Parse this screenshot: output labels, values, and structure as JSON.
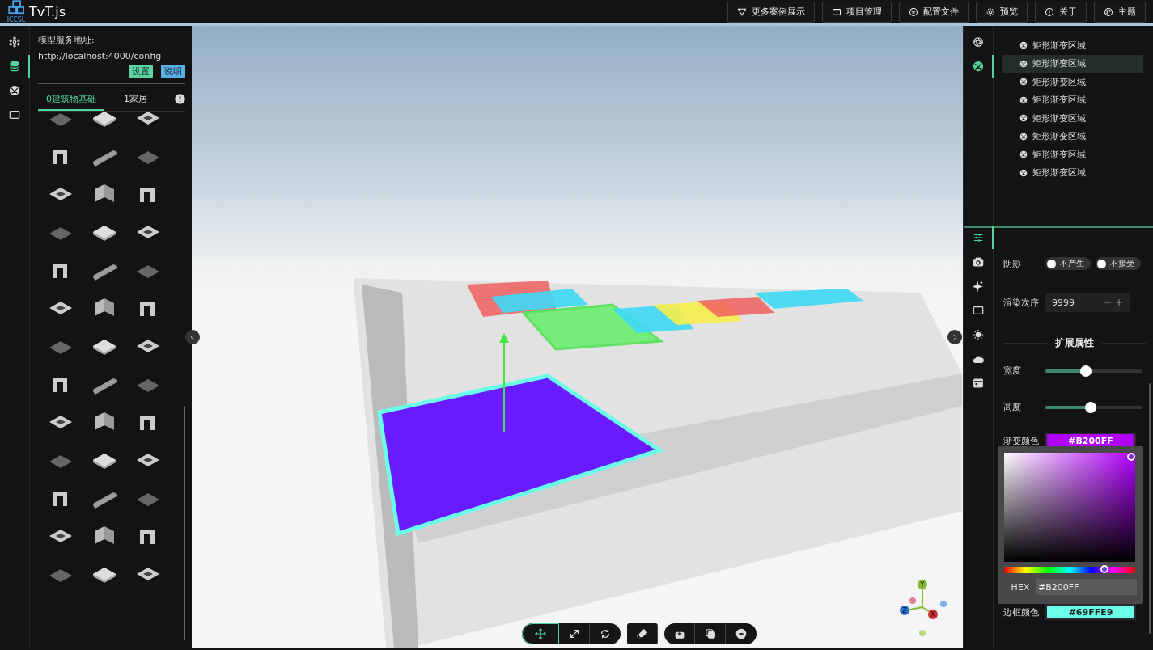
{
  "header": {
    "logo_caption": "ICESL",
    "title": "TvT.js",
    "buttons": [
      {
        "kind": "cases",
        "label": "更多案例展示"
      },
      {
        "kind": "project",
        "label": "项目管理"
      },
      {
        "kind": "config",
        "label": "配置文件"
      },
      {
        "kind": "preview",
        "label": "预览"
      },
      {
        "kind": "about",
        "label": "关于"
      },
      {
        "kind": "theme",
        "label": "主题"
      }
    ]
  },
  "left_rail": [
    {
      "kind": "nodes",
      "selected": false
    },
    {
      "kind": "database",
      "selected": true
    },
    {
      "kind": "ball",
      "selected": false
    },
    {
      "kind": "screen",
      "selected": false
    }
  ],
  "model_panel": {
    "label": "模型服务地址:",
    "url": "http://localhost:4000/config",
    "buttons": [
      {
        "kind": "set",
        "label": "设置"
      },
      {
        "kind": "help",
        "label": "说明"
      }
    ],
    "tabs": [
      {
        "label": "0建筑物基础",
        "selected": true
      },
      {
        "label": "1家居",
        "selected": false
      }
    ]
  },
  "right_rail": [
    {
      "kind": "aperture",
      "selected": false
    },
    {
      "kind": "ball",
      "selected": true
    }
  ],
  "object_list": [
    {
      "label": "矩形渐变区域",
      "selected": false
    },
    {
      "label": "矩形渐变区域",
      "selected": true
    },
    {
      "label": "矩形渐变区域",
      "selected": false
    },
    {
      "label": "矩形渐变区域",
      "selected": false
    },
    {
      "label": "矩形渐变区域",
      "selected": false
    },
    {
      "label": "矩形渐变区域",
      "selected": false
    },
    {
      "label": "矩形渐变区域",
      "selected": false
    },
    {
      "label": "矩形渐变区域",
      "selected": false
    }
  ],
  "props_rail": [
    {
      "kind": "sliders",
      "selected": true
    },
    {
      "kind": "camera",
      "selected": false
    },
    {
      "kind": "sparkle",
      "selected": false
    },
    {
      "kind": "screen",
      "selected": false
    },
    {
      "kind": "sun",
      "selected": false
    },
    {
      "kind": "cloud",
      "selected": false
    },
    {
      "kind": "window",
      "selected": false
    }
  ],
  "properties": {
    "shadow": {
      "label": "阴影",
      "toggles": [
        {
          "label": "不产生",
          "on": false
        },
        {
          "label": "不接受",
          "on": false
        }
      ]
    },
    "render_order": {
      "label": "渲染次序",
      "value": "9999"
    },
    "section_title": "扩展属性",
    "sliders": [
      {
        "label": "宽度",
        "level": 0.42
      },
      {
        "label": "高度",
        "level": 0.47
      }
    ],
    "gradient_color": {
      "label": "渐变颜色",
      "value": "#B200FF",
      "color": "#b200ff"
    },
    "color_picker": {
      "hue": {
        "level": 0.77
      },
      "hex_label": "HEX",
      "hex_value": "#B200FF"
    },
    "border_color": {
      "label": "边框颜色",
      "value": "#69FFE9",
      "color": "#69ffe9"
    }
  },
  "toolbar": [
    [
      {
        "kind": "move",
        "selected": true
      },
      {
        "kind": "scale",
        "selected": false
      },
      {
        "kind": "rotate",
        "selected": false
      }
    ],
    [
      {
        "kind": "magnet",
        "selected": false
      }
    ],
    [
      {
        "kind": "import",
        "selected": false
      },
      {
        "kind": "copy",
        "selected": false
      },
      {
        "kind": "delete",
        "selected": false
      }
    ]
  ],
  "gizmo": {
    "y": "Y",
    "z": "Z",
    "x": "X"
  }
}
